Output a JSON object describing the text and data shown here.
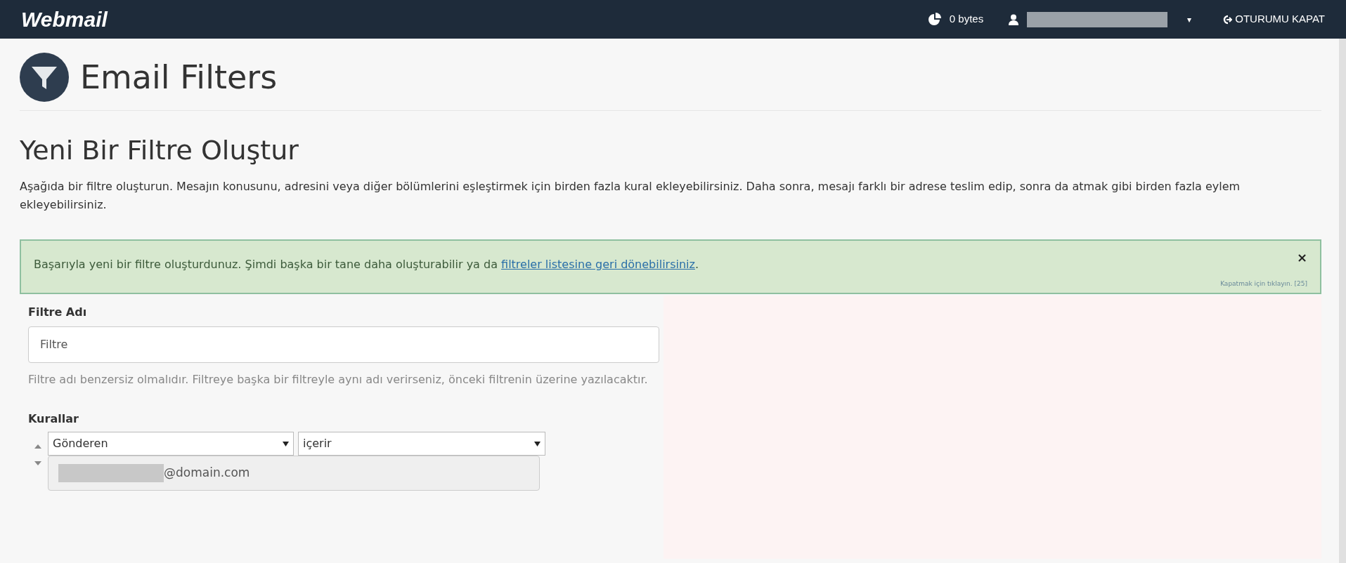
{
  "topbar": {
    "logo": "Webmail",
    "disk_usage": "0 bytes",
    "caret": "▾",
    "logout": "OTURUMU KAPAT"
  },
  "page_title": "Email Filters",
  "section_title": "Yeni Bir Filtre Oluştur",
  "description": "Aşağıda bir filtre oluşturun. Mesajın konusunu, adresini veya diğer bölümlerini eşleştirmek için birden fazla kural ekleyebilirsiniz. Daha sonra, mesajı farklı bir adrese teslim edip, sonra da atmak gibi birden fazla eylem ekleyebilirsiniz.",
  "alert": {
    "text": "Başarıyla yeni bir filtre oluşturdunuz. Şimdi başka bir tane daha oluşturabilir ya da ",
    "link": "filtreler listesine geri dönebilirsiniz",
    "after": ".",
    "close": "×",
    "hint": "Kapatmak için tıklayın. [25]"
  },
  "filter_name": {
    "label": "Filtre Adı",
    "value": "Filtre",
    "help": "Filtre adı benzersiz olmalıdır. Filtreye başka bir filtreyle aynı adı verirseniz, önceki filtrenin üzerine yazılacaktır."
  },
  "rules": {
    "label": "Kurallar",
    "part": "Gönderen",
    "match": "içerir",
    "value": "@domain.com"
  }
}
